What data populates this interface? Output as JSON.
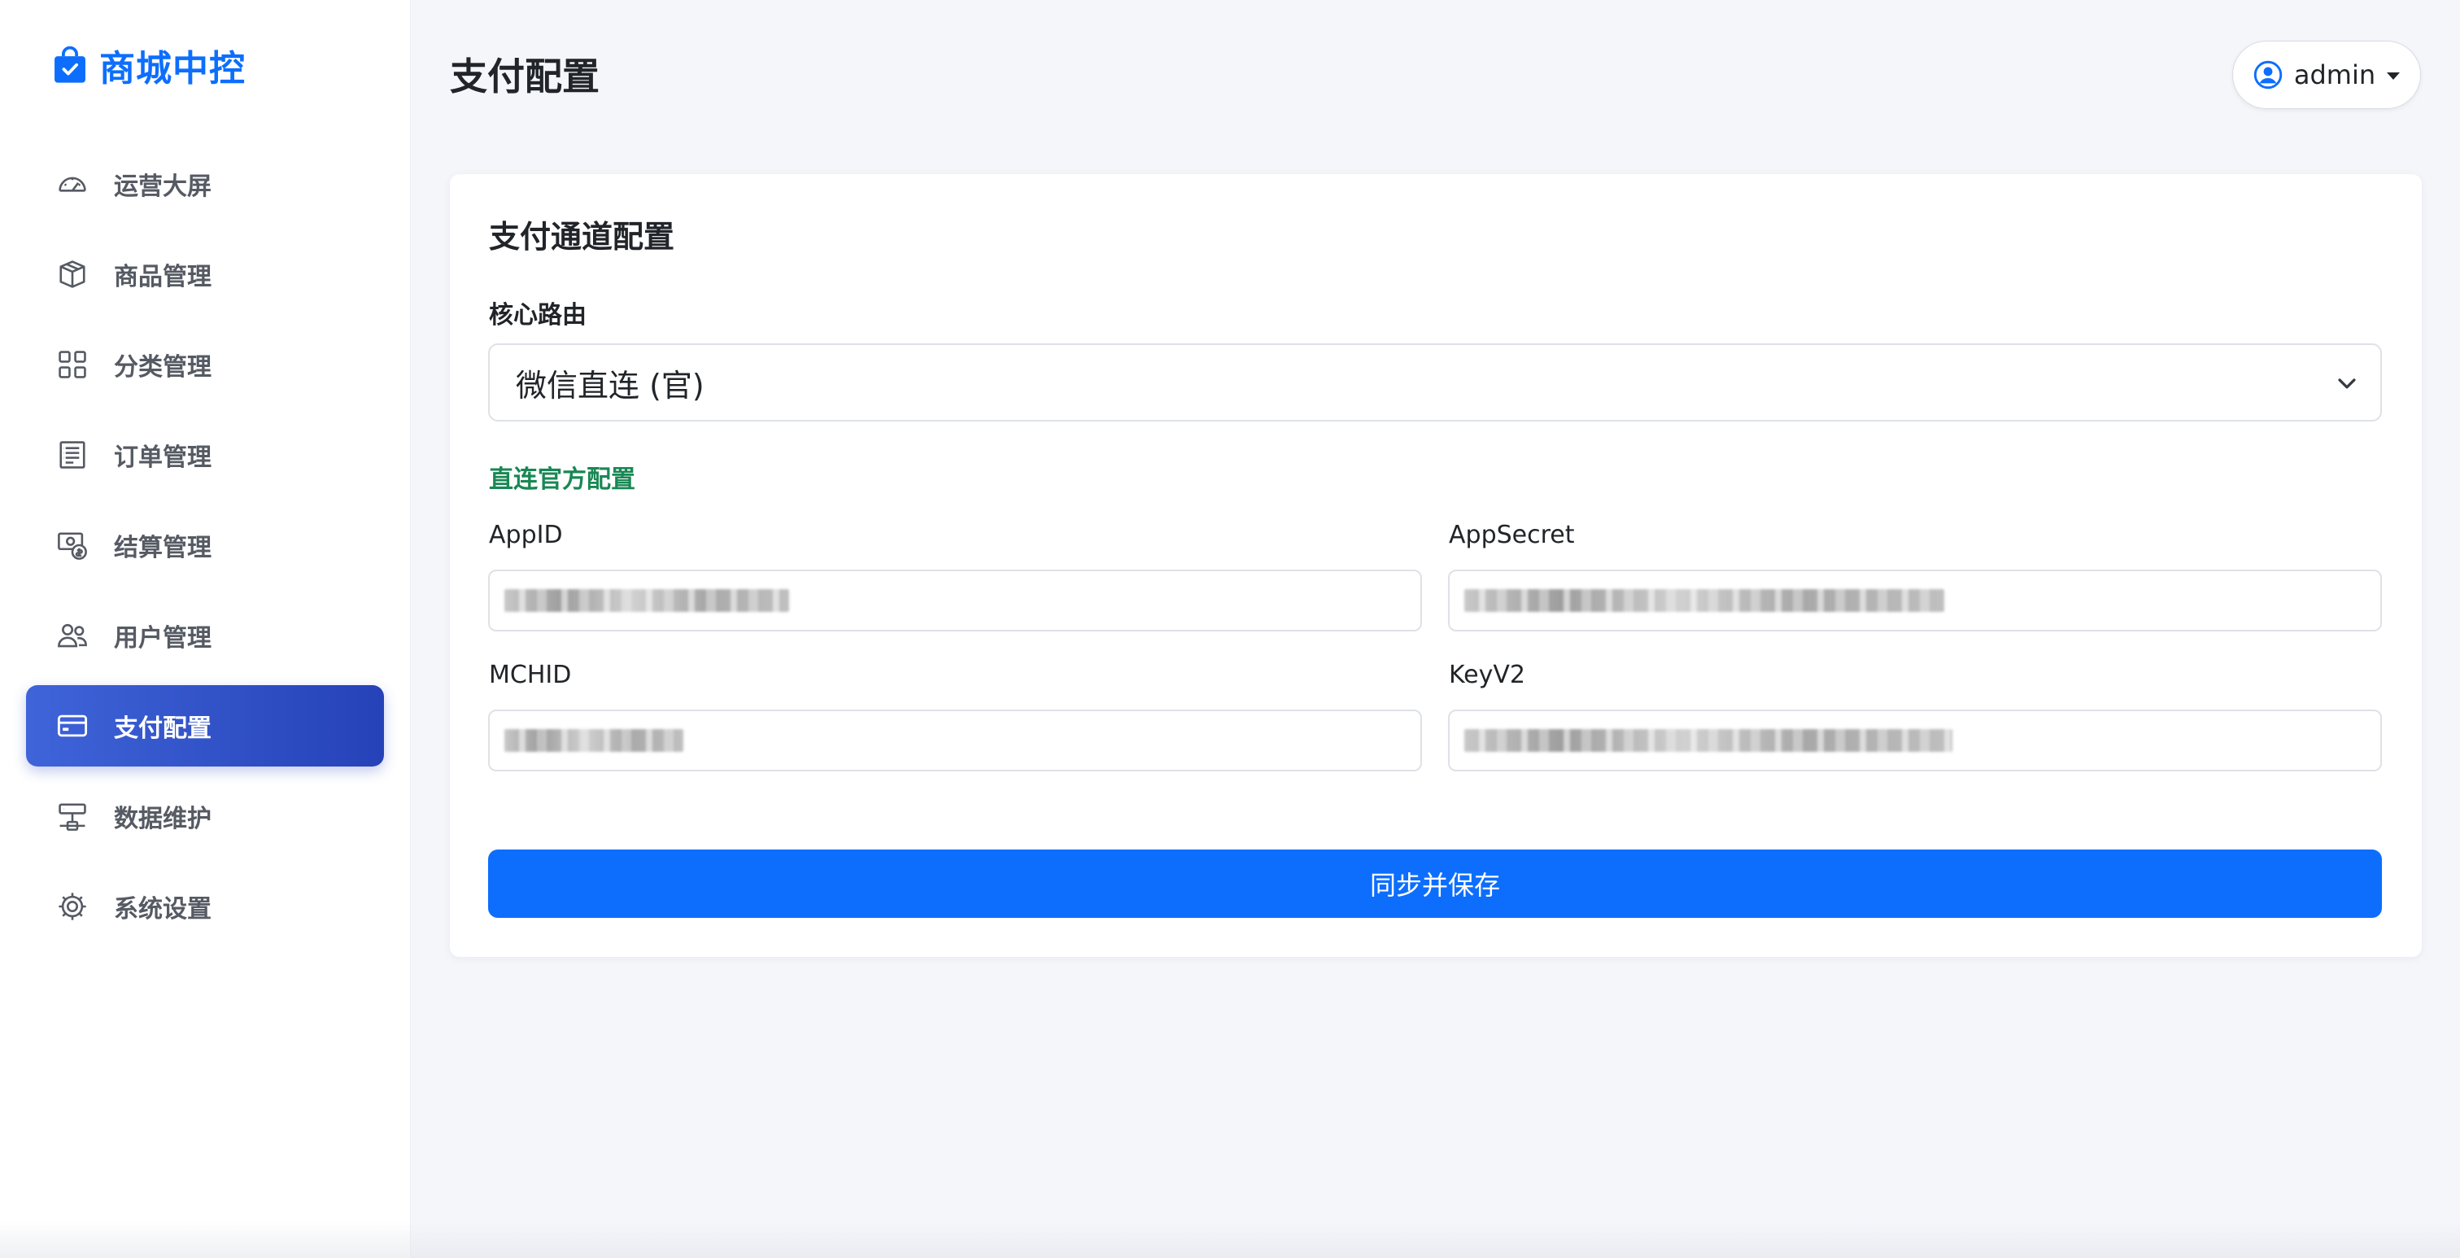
{
  "brand": {
    "name": "商城中控",
    "color": "#0d6efd"
  },
  "sidebar": {
    "items": [
      {
        "label": "运营大屏",
        "icon": "speedometer-icon",
        "active": false
      },
      {
        "label": "商品管理",
        "icon": "box-icon",
        "active": false
      },
      {
        "label": "分类管理",
        "icon": "grid-icon",
        "active": false
      },
      {
        "label": "订单管理",
        "icon": "receipt-icon",
        "active": false
      },
      {
        "label": "结算管理",
        "icon": "cash-coin-icon",
        "active": false
      },
      {
        "label": "用户管理",
        "icon": "people-icon",
        "active": false
      },
      {
        "label": "支付配置",
        "icon": "credit-card-icon",
        "active": true
      },
      {
        "label": "数据维护",
        "icon": "server-icon",
        "active": false
      },
      {
        "label": "系统设置",
        "icon": "gear-icon",
        "active": false
      }
    ]
  },
  "header": {
    "title": "支付配置",
    "user": {
      "name": "admin",
      "icon": "person-circle-icon"
    }
  },
  "card": {
    "title": "支付通道配置",
    "route": {
      "label": "核心路由",
      "selected": "微信直连 (官)"
    },
    "section_title": "直连官方配置",
    "fields": {
      "appid": {
        "label": "AppID",
        "masked": true
      },
      "appsecret": {
        "label": "AppSecret",
        "masked": true
      },
      "mchid": {
        "label": "MCHID",
        "masked": true
      },
      "keyv2": {
        "label": "KeyV2",
        "masked": true
      }
    },
    "save_label": "同步并保存"
  },
  "colors": {
    "accent": "#0d6efd",
    "active_nav": "#3050c8",
    "section_green": "#198754",
    "background": "#f5f6fa"
  }
}
